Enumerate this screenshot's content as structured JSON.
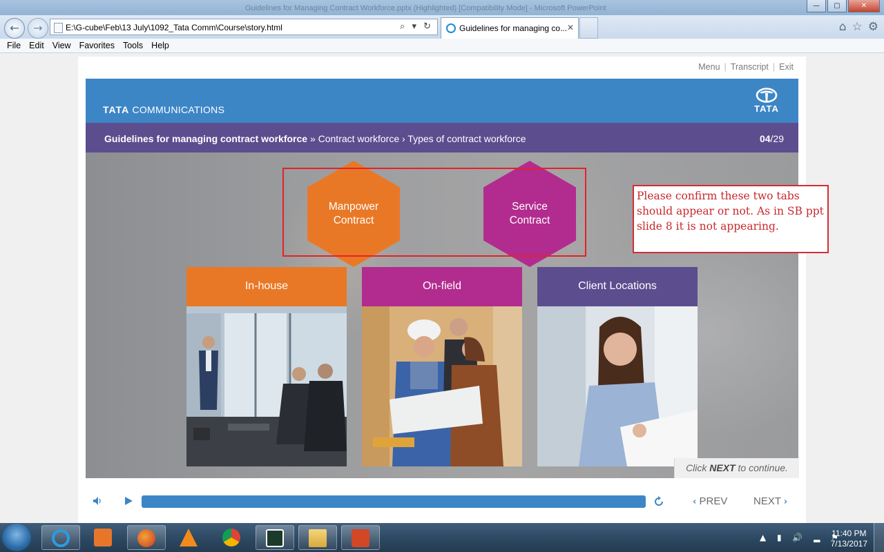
{
  "browser": {
    "window_title": "Guidelines for Managing Contract Workforce.pptx (Highlighted) [Compatibility Mode] - Microsoft PowerPoint",
    "address": "E:\\G-cube\\Feb\\13 July\\1092_Tata Comm\\Course\\story.html",
    "address_tools": "⌕ ▾ ↻",
    "tab_title": "Guidelines for managing co...",
    "tab_close": "✕",
    "window_buttons": {
      "minimize": "—",
      "maximize": "▢",
      "close": "✕"
    },
    "nav": {
      "back": "←",
      "forward": "→"
    },
    "right_icons": {
      "home": "⌂",
      "favorites": "☆",
      "settings": "⚙"
    },
    "menu": [
      "File",
      "Edit",
      "View",
      "Favorites",
      "Tools",
      "Help"
    ]
  },
  "course": {
    "top_links": {
      "menu": "Menu",
      "sep1": "|",
      "transcript": "Transcript",
      "sep2": "|",
      "exit": "Exit"
    },
    "brand": {
      "bold": "TATA",
      "rest": " COMMUNICATIONS"
    },
    "logo_word": "TATA",
    "breadcrumb": {
      "title": "Guidelines for managing contract workforce",
      "rest": " » Contract workforce › Types of contract workforce"
    },
    "page": {
      "current": "04",
      "total": "/29"
    },
    "hexagons": {
      "manpower": "Manpower\nContract",
      "service": "Service\nContract"
    },
    "cards": [
      {
        "label": "In-house",
        "color": "#e97826"
      },
      {
        "label": "On-field",
        "color": "#b22c8f"
      },
      {
        "label": "Client Locations",
        "color": "#5c4d8f"
      }
    ],
    "review_note": "Please confirm these two tabs should appear or not. As in SB ppt slide 8 it is not appearing.",
    "continue": {
      "pre": "Click ",
      "bold": "NEXT",
      "post": " to continue."
    },
    "controls": {
      "prev": "PREV",
      "next": "NEXT",
      "prev_chevron": "‹",
      "next_chevron": "›"
    },
    "colors": {
      "header_blue": "#3d86c6",
      "purple": "#5c4d8f",
      "orange": "#e97826",
      "magenta": "#b22c8f",
      "annotation_red": "#e32227"
    }
  },
  "taskbar": {
    "tray_icons": "▲ ▮ 🔊 ▂ ⚑",
    "time": "11:40 PM",
    "date": "7/13/2017"
  }
}
